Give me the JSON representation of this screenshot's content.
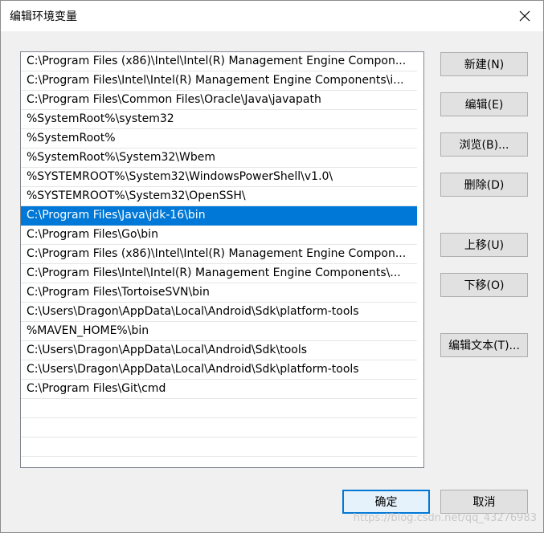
{
  "window": {
    "title": "编辑环境变量"
  },
  "paths": [
    "C:\\Program Files (x86)\\Intel\\Intel(R) Management Engine Compon...",
    "C:\\Program Files\\Intel\\Intel(R) Management Engine Components\\i...",
    "C:\\Program Files\\Common Files\\Oracle\\Java\\javapath",
    "%SystemRoot%\\system32",
    "%SystemRoot%",
    "%SystemRoot%\\System32\\Wbem",
    "%SYSTEMROOT%\\System32\\WindowsPowerShell\\v1.0\\",
    "%SYSTEMROOT%\\System32\\OpenSSH\\",
    "C:\\Program Files\\Java\\jdk-16\\bin",
    "C:\\Program Files\\Go\\bin",
    "C:\\Program Files (x86)\\Intel\\Intel(R) Management Engine Compon...",
    "C:\\Program Files\\Intel\\Intel(R) Management Engine Components\\...",
    "C:\\Program Files\\TortoiseSVN\\bin",
    "C:\\Users\\Dragon\\AppData\\Local\\Android\\Sdk\\platform-tools",
    "%MAVEN_HOME%\\bin",
    "C:\\Users\\Dragon\\AppData\\Local\\Android\\Sdk\\tools",
    "C:\\Users\\Dragon\\AppData\\Local\\Android\\Sdk\\platform-tools",
    "C:\\Program Files\\Git\\cmd",
    "",
    "",
    ""
  ],
  "selected_index": 8,
  "buttons": {
    "new": "新建(N)",
    "edit": "编辑(E)",
    "browse": "浏览(B)...",
    "delete": "删除(D)",
    "move_up": "上移(U)",
    "move_down": "下移(O)",
    "edit_text": "编辑文本(T)...",
    "ok": "确定",
    "cancel": "取消"
  },
  "watermark": "https://blog.csdn.net/qq_43276983",
  "colors": {
    "selection": "#0078d7",
    "primary_border": "#0078d7"
  },
  "icons": {
    "close": "close-icon"
  }
}
